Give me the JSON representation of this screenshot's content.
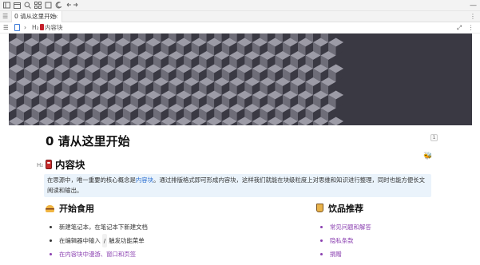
{
  "titlebar": {
    "icons": [
      "sidebar-toggle-icon",
      "calendar-icon",
      "search-icon",
      "grid-icon",
      "square-icon",
      "moon-icon",
      "undo-icon",
      "redo-icon"
    ],
    "right": "—"
  },
  "tabs": [
    {
      "label": "0 请从这里开始",
      "close": "×"
    }
  ],
  "tabbar_menu": "⋮",
  "breadcrumb": {
    "separator": "›",
    "heading_label": "H₂",
    "block_label": "内容块"
  },
  "doc": {
    "title": "0 请从这里开始",
    "badge_count": "1",
    "h2_gutter": "H₂",
    "h2": "内容块",
    "callout_before": "在思源中，唯一重要的核心概念是",
    "callout_highlight": "内容块",
    "callout_after": "。通过排版格式即可形成内容块，这样我们就能在块级粒度上对思维和知识进行整理，同时也能方便长文阅读和输出。",
    "section_left": "开始食用",
    "section_right": "饮品推荐",
    "left_items": [
      {
        "text": "新建笔记本，在笔记本下新建文档"
      },
      {
        "text_before": "在编辑器中输入",
        "kbd": "/",
        "text_after": "触发功能菜单"
      },
      {
        "text": "在内容块中漫游、窗口和页签"
      }
    ],
    "right_items": [
      "常见问题和解答",
      "隐私条款",
      "捐赠"
    ]
  },
  "colors": {
    "banner_dark": "#3a3943",
    "banner_mid": "#6e6d78",
    "banner_light": "#9c9ba6",
    "callout_bg": "#eaf3fb",
    "link": "#8a3fb0",
    "highlight": "#2c6fd1"
  }
}
